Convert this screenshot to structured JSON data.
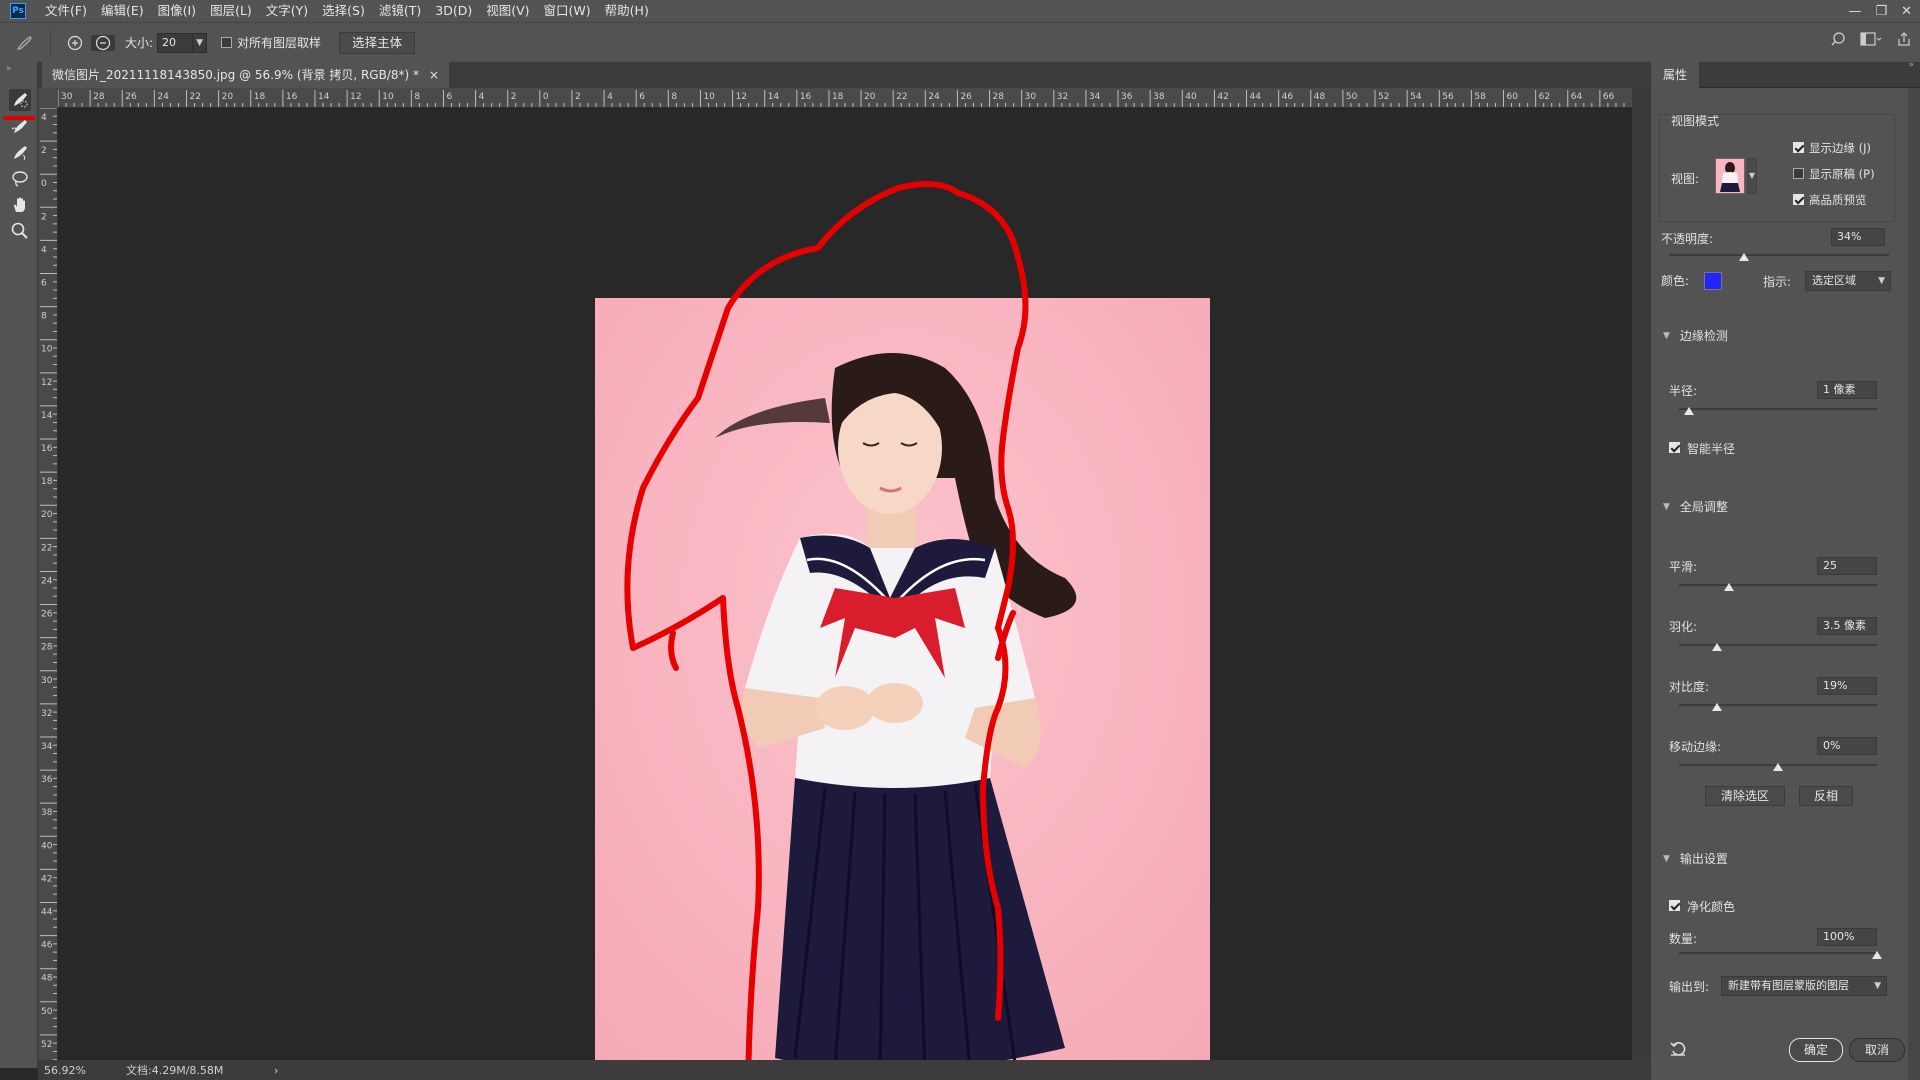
{
  "app": {
    "logo": "Ps",
    "menu": [
      "文件(F)",
      "编辑(E)",
      "图像(I)",
      "图层(L)",
      "文字(Y)",
      "选择(S)",
      "滤镜(T)",
      "3D(D)",
      "视图(V)",
      "窗口(W)",
      "帮助(H)"
    ]
  },
  "options": {
    "size_label": "大小:",
    "size_value": "20",
    "sample_all_label": "对所有图层取样",
    "sample_all_checked": false,
    "select_subject_label": "选择主体"
  },
  "tools": [
    "quick-selection-tool",
    "refine-edge-brush-tool",
    "brush-tool",
    "lasso-tool",
    "hand-tool",
    "zoom-tool"
  ],
  "document": {
    "tab_title": "微信图片_20211118143850.jpg @ 56.9% (背景 拷贝, RGB/8*) *",
    "tab_close": "×",
    "ruler_h_labels": [
      "30",
      "28",
      "26",
      "24",
      "22",
      "20",
      "18",
      "16",
      "14",
      "12",
      "10",
      "8",
      "6",
      "4",
      "2",
      "0",
      "2",
      "4",
      "6",
      "8",
      "10",
      "12",
      "14",
      "16",
      "18",
      "20",
      "22",
      "24",
      "26",
      "28",
      "30",
      "32",
      "34",
      "36",
      "38",
      "40",
      "42",
      "44",
      "46",
      "48",
      "50",
      "52",
      "54",
      "56",
      "58",
      "60",
      "62",
      "64",
      "66"
    ],
    "ruler_v_labels": [
      "4",
      "2",
      "0",
      "2",
      "4",
      "6",
      "8",
      "10",
      "12",
      "14",
      "16",
      "18",
      "20",
      "22",
      "24",
      "26",
      "28",
      "30",
      "32",
      "34",
      "36",
      "38",
      "40",
      "42",
      "44",
      "46",
      "48",
      "50",
      "52"
    ],
    "zoom": "56.92%",
    "doc_size": "文档:4.29M/8.58M",
    "status_arrow": "›"
  },
  "colors": {
    "photo_bg": "#f8b6c1",
    "stroke": "#e60000",
    "overlay_color": "#2323ff",
    "skirt": "#1d1a3c",
    "hair": "#2a1a18"
  },
  "panel": {
    "tab": "属性",
    "view_mode": {
      "title": "视图模式",
      "view_label": "视图:",
      "show_edge": "显示边缘 (J)",
      "show_edge_checked": true,
      "show_original": "显示原稿 (P)",
      "show_original_checked": false,
      "hq_preview": "高品质预览",
      "hq_preview_checked": true
    },
    "opacity": {
      "label": "不透明度:",
      "value": "34%",
      "fraction": 0.34
    },
    "color_label": "颜色:",
    "indicate_label": "指示:",
    "indicate_value": "选定区域",
    "edge_detection": {
      "title": "边缘检测",
      "radius_label": "半径:",
      "radius_value": "1 像素",
      "radius_fraction": 0.05,
      "smart_radius": "智能半径",
      "smart_radius_checked": true
    },
    "global": {
      "title": "全局调整",
      "smooth_label": "平滑:",
      "smooth_value": "25",
      "smooth_fraction": 0.25,
      "feather_label": "羽化:",
      "feather_value": "3.5 像素",
      "feather_fraction": 0.19,
      "contrast_label": "对比度:",
      "contrast_value": "19%",
      "contrast_fraction": 0.19,
      "shift_label": "移动边缘:",
      "shift_value": "0%",
      "shift_fraction": 0.5,
      "clear_btn": "清除选区",
      "invert_btn": "反相"
    },
    "output": {
      "title": "输出设置",
      "decontaminate": "净化颜色",
      "decontaminate_checked": true,
      "amount_label": "数量:",
      "amount_value": "100%",
      "amount_fraction": 1.0,
      "output_to_label": "输出到:",
      "output_to_value": "新建带有图层蒙版的图层"
    },
    "ok": "确定",
    "cancel": "取消"
  }
}
